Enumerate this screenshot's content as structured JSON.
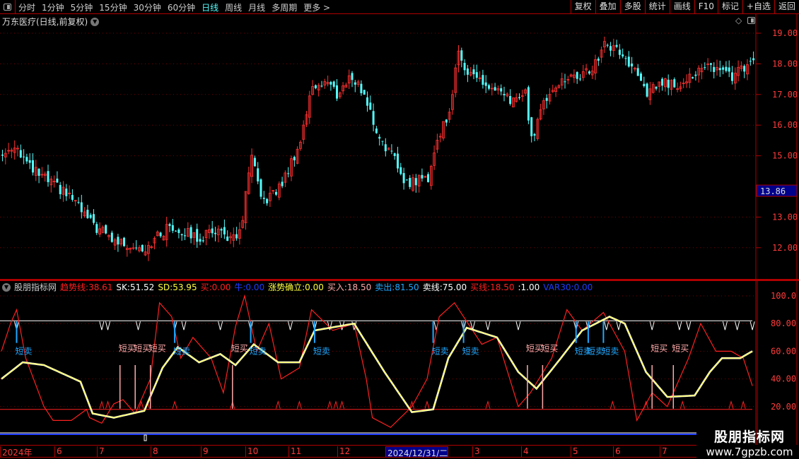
{
  "topbar": {
    "periods": [
      "分时",
      "1分钟",
      "5分钟",
      "15分钟",
      "30分钟",
      "60分钟",
      "日线",
      "周线",
      "月线",
      "多周期",
      "更多 >"
    ],
    "active": "日线",
    "tools": [
      "复权",
      "叠加",
      "多股",
      "统计",
      "画线",
      "F10",
      "标记",
      "+自选",
      "返回"
    ]
  },
  "title": "万东医疗(日线,前复权)",
  "price_axis": {
    "ticks": [
      "19.00",
      "18.00",
      "17.00",
      "16.00",
      "15.00",
      "13.00",
      "12.00"
    ],
    "tick_values": [
      19,
      18,
      17,
      16,
      15,
      13,
      12
    ],
    "current": "13.86",
    "current_value": 13.86
  },
  "indicator": {
    "name": "股朋指标网",
    "fields": [
      {
        "label": "趋势线:",
        "value": "38.61",
        "color": "#ff2020"
      },
      {
        "label": "SK:",
        "value": "51.52",
        "color": "#ffffff"
      },
      {
        "label": "SD:",
        "value": "53.95",
        "color": "#ffff40"
      },
      {
        "label": "买:",
        "value": "0.00",
        "color": "#ff2020"
      },
      {
        "label": "牛:",
        "value": "0.00",
        "color": "#1e3cff"
      },
      {
        "label": "涨势确立:",
        "value": "0.00",
        "color": "#ffff40"
      },
      {
        "label": "买入:",
        "value": "18.50",
        "color": "#ffaaaa"
      },
      {
        "label": "卖出:",
        "value": "81.50",
        "color": "#20a8ff"
      },
      {
        "label": "卖线:",
        "value": "75.00",
        "color": "#ffffff"
      },
      {
        "label": "买线:",
        "value": "18.50",
        "color": "#ff2020"
      },
      {
        "label": ":",
        "value": "1.00",
        "color": "#ffffff"
      },
      {
        "label": "VAR30:",
        "value": "0.00",
        "color": "#1e3cff"
      }
    ],
    "ticks": [
      "100.0",
      "80.00",
      "60.00",
      "40.00",
      "20.00"
    ],
    "tick_values": [
      100,
      80,
      60,
      40,
      20
    ],
    "sell_label": "短卖",
    "buy_label": "短买"
  },
  "dates": [
    "2024年",
    "6",
    "7",
    "8",
    "9",
    "10",
    "11",
    "12",
    "2024/12/31/二",
    "3",
    "4",
    "5",
    "6",
    "7"
  ],
  "watermark": {
    "name": "股朋指标网",
    "url": "www.7gpzb.com"
  },
  "colors": {
    "up": "#ff3030",
    "down": "#54fcfc",
    "grid": "#b00000"
  },
  "chart_data": {
    "type": "candlestick",
    "bars": 248,
    "ylim": [
      11.4,
      19.6
    ],
    "close_anchors": [
      [
        0,
        15.0
      ],
      [
        4,
        15.4
      ],
      [
        9,
        14.6
      ],
      [
        16,
        14.1
      ],
      [
        23,
        13.6
      ],
      [
        29,
        12.8
      ],
      [
        37,
        12.2
      ],
      [
        47,
        12.0
      ],
      [
        55,
        12.7
      ],
      [
        60,
        12.5
      ],
      [
        65,
        12.3
      ],
      [
        70,
        12.6
      ],
      [
        77,
        12.2
      ],
      [
        79,
        13.0
      ],
      [
        82,
        15.0
      ],
      [
        85,
        13.5
      ],
      [
        90,
        13.8
      ],
      [
        93,
        14.3
      ],
      [
        98,
        15.5
      ],
      [
        102,
        17.3
      ],
      [
        107,
        17.4
      ],
      [
        110,
        17.0
      ],
      [
        115,
        17.6
      ],
      [
        119,
        17.0
      ],
      [
        123,
        15.8
      ],
      [
        128,
        15.0
      ],
      [
        133,
        14.1
      ],
      [
        140,
        14.3
      ],
      [
        143,
        15.5
      ],
      [
        147,
        16.5
      ],
      [
        150,
        18.3
      ],
      [
        153,
        17.8
      ],
      [
        160,
        17.2
      ],
      [
        167,
        16.8
      ],
      [
        172,
        17.0
      ],
      [
        174,
        15.5
      ],
      [
        177,
        16.5
      ],
      [
        181,
        17.3
      ],
      [
        186,
        17.5
      ],
      [
        193,
        17.7
      ],
      [
        198,
        18.6
      ],
      [
        202,
        18.5
      ],
      [
        207,
        17.9
      ],
      [
        212,
        17.0
      ],
      [
        216,
        17.4
      ],
      [
        221,
        17.3
      ],
      [
        226,
        17.6
      ],
      [
        230,
        17.8
      ],
      [
        235,
        17.9
      ],
      [
        240,
        17.6
      ],
      [
        247,
        18.0
      ]
    ],
    "indicator": {
      "ylim": [
        0,
        105
      ],
      "sd_line": [
        [
          0,
          40
        ],
        [
          7,
          52
        ],
        [
          14,
          50
        ],
        [
          26,
          38
        ],
        [
          30,
          15
        ],
        [
          37,
          12
        ],
        [
          47,
          17
        ],
        [
          53,
          48
        ],
        [
          58,
          63
        ],
        [
          65,
          52
        ],
        [
          72,
          58
        ],
        [
          77,
          50
        ],
        [
          83,
          65
        ],
        [
          91,
          52
        ],
        [
          98,
          52
        ],
        [
          103,
          75
        ],
        [
          116,
          80
        ],
        [
          126,
          45
        ],
        [
          135,
          16
        ],
        [
          142,
          18
        ],
        [
          147,
          55
        ],
        [
          153,
          77
        ],
        [
          163,
          70
        ],
        [
          170,
          45
        ],
        [
          176,
          33
        ],
        [
          184,
          55
        ],
        [
          191,
          75
        ],
        [
          200,
          85
        ],
        [
          205,
          80
        ],
        [
          212,
          45
        ],
        [
          219,
          27
        ],
        [
          228,
          28
        ],
        [
          233,
          45
        ],
        [
          237,
          55
        ],
        [
          243,
          55
        ],
        [
          247,
          60
        ]
      ],
      "trend_line": [
        [
          0,
          60
        ],
        [
          3,
          80
        ],
        [
          5,
          90
        ],
        [
          8,
          55
        ],
        [
          14,
          20
        ],
        [
          17,
          10
        ],
        [
          23,
          10
        ],
        [
          28,
          18
        ],
        [
          29,
          12
        ],
        [
          33,
          8
        ],
        [
          37,
          22
        ],
        [
          40,
          25
        ],
        [
          44,
          15
        ],
        [
          49,
          40
        ],
        [
          52,
          95
        ],
        [
          56,
          85
        ],
        [
          59,
          55
        ],
        [
          63,
          70
        ],
        [
          69,
          55
        ],
        [
          73,
          30
        ],
        [
          77,
          78
        ],
        [
          80,
          100
        ],
        [
          84,
          60
        ],
        [
          88,
          80
        ],
        [
          92,
          40
        ],
        [
          98,
          48
        ],
        [
          102,
          90
        ],
        [
          109,
          75
        ],
        [
          116,
          80
        ],
        [
          120,
          40
        ],
        [
          122,
          12
        ],
        [
          128,
          5
        ],
        [
          135,
          20
        ],
        [
          140,
          40
        ],
        [
          144,
          85
        ],
        [
          149,
          95
        ],
        [
          152,
          85
        ],
        [
          158,
          65
        ],
        [
          163,
          70
        ],
        [
          170,
          20
        ],
        [
          174,
          30
        ],
        [
          181,
          55
        ],
        [
          186,
          90
        ],
        [
          191,
          75
        ],
        [
          198,
          88
        ],
        [
          205,
          60
        ],
        [
          209,
          10
        ],
        [
          214,
          30
        ],
        [
          219,
          20
        ],
        [
          226,
          55
        ],
        [
          230,
          80
        ],
        [
          235,
          60
        ],
        [
          240,
          60
        ],
        [
          244,
          55
        ],
        [
          247,
          35
        ]
      ],
      "sell_line": 81.5,
      "buy_line": 18.5,
      "sell_signals": [
        5,
        57,
        82,
        103,
        142,
        152,
        189,
        193,
        198
      ],
      "buy_signals": [
        39,
        44,
        49,
        76,
        173,
        178,
        214,
        221
      ],
      "top_markers": [
        5,
        33,
        35,
        45,
        57,
        60,
        72,
        82,
        95,
        103,
        108,
        112,
        116,
        143,
        152,
        155,
        160,
        170,
        189,
        193,
        199,
        203,
        214,
        223,
        226,
        238,
        242,
        247
      ],
      "bottom_markers": [
        33,
        35,
        46,
        48,
        57,
        76,
        91,
        98,
        108,
        110,
        112,
        135,
        140,
        160,
        201,
        212,
        224,
        240,
        244
      ]
    }
  }
}
